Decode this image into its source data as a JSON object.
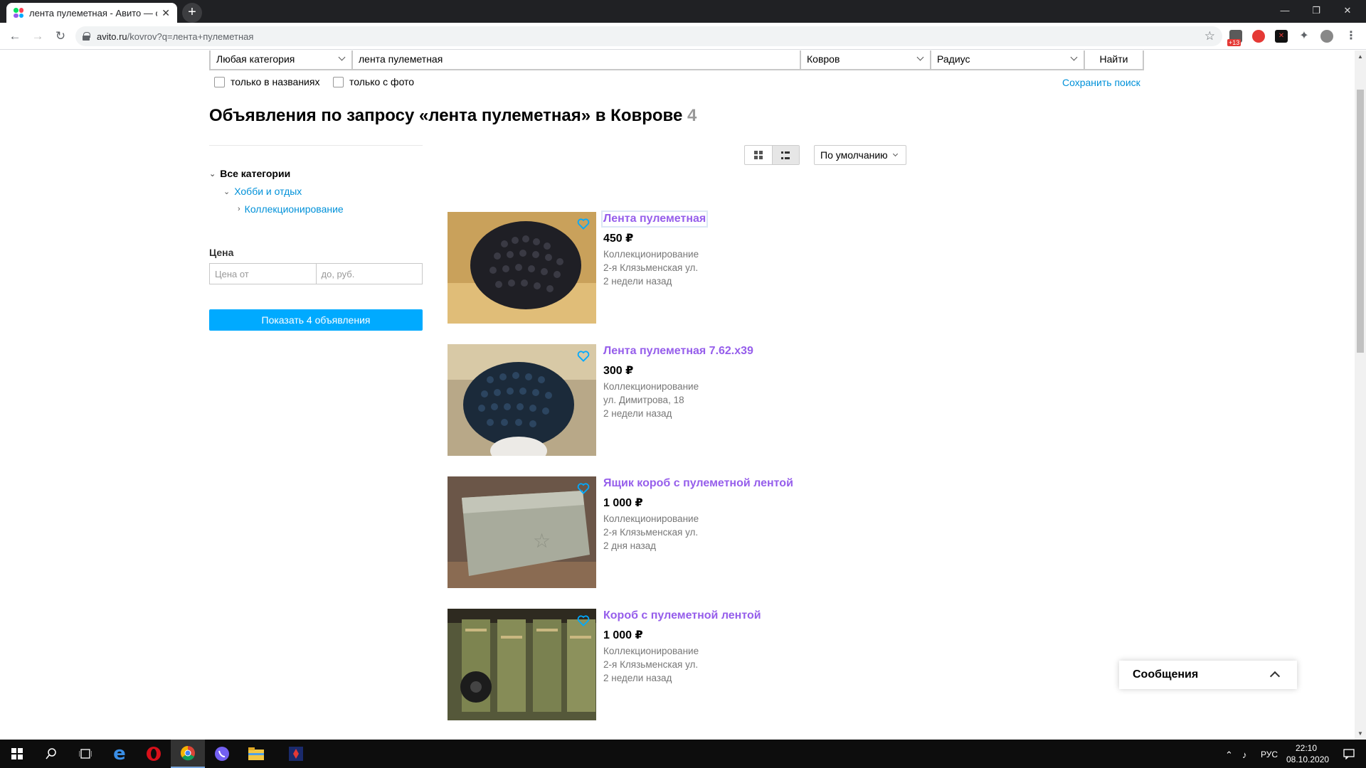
{
  "browser": {
    "tab_title": "лента пулеметная - Авито — об",
    "tab_close": "✕",
    "new_tab": "+",
    "url_host": "avito.ru",
    "url_path": "/kovrov?q=лента+пулеметная",
    "window_controls": [
      "—",
      "❐",
      "✕"
    ],
    "extension_badge": "+13"
  },
  "search": {
    "category": "Любая категория",
    "query": "лента пулеметная",
    "location": "Ковров",
    "radius": "Радиус",
    "find_button": "Найти",
    "only_titles": "только в названиях",
    "only_photo": "только с фото",
    "save_search": "Сохранить поиск"
  },
  "page": {
    "title": "Объявления по запросу «лента пулеметная» в Коврове",
    "count": "4"
  },
  "sidebar": {
    "categories": [
      {
        "label": "Все категории",
        "level": 0
      },
      {
        "label": "Хобби и отдых",
        "level": 1
      },
      {
        "label": "Коллекционирование",
        "level": 2
      }
    ],
    "price_label": "Цена",
    "price_from_placeholder": "Цена от",
    "price_to_placeholder": "до, руб.",
    "show_button": "Показать 4 объявления"
  },
  "controls": {
    "sort": "По умолчанию"
  },
  "listings": [
    {
      "title": "Лента пулеметная",
      "price": "450 ₽",
      "category": "Коллекционирование",
      "address": "2-я Клязьменская ул.",
      "date": "2 недели назад"
    },
    {
      "title": "Лента пулеметная 7.62.х39",
      "price": "300 ₽",
      "category": "Коллекционирование",
      "address": "ул. Димитрова, 18",
      "date": "2 недели назад"
    },
    {
      "title": "Ящик короб с пулеметной лентой",
      "price": "1 000 ₽",
      "category": "Коллекционирование",
      "address": "2-я Клязьменская ул.",
      "date": "2 дня назад"
    },
    {
      "title": "Короб с пулеметной лентой",
      "price": "1 000 ₽",
      "category": "Коллекционирование",
      "address": "2-я Клязьменская ул.",
      "date": "2 недели назад"
    }
  ],
  "messages": {
    "label": "Сообщения"
  },
  "taskbar": {
    "lang": "РУС",
    "time": "22:10",
    "date": "08.10.2020"
  },
  "colors": {
    "link": "#0091d9",
    "listing_title": "#965eeb",
    "primary_button": "#00aaff"
  },
  "icons": [
    "search-icon",
    "heart-icon",
    "grid-view-icon",
    "list-view-icon",
    "star-icon",
    "lock-icon",
    "windows-start-icon"
  ]
}
